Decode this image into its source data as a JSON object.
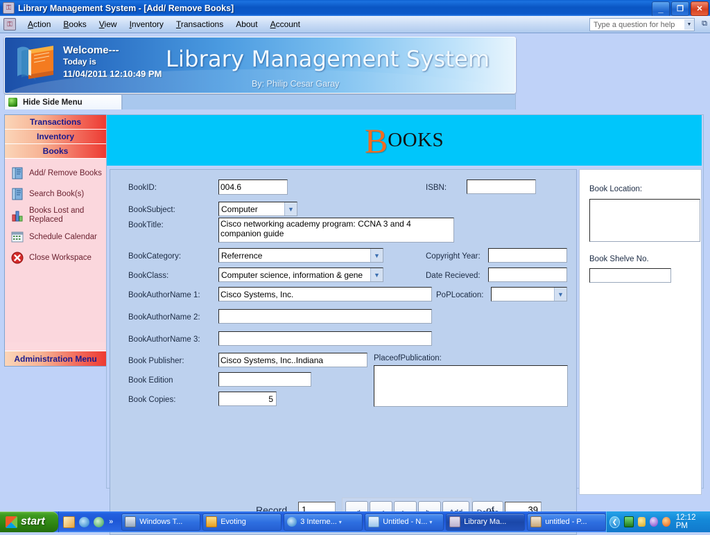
{
  "window": {
    "title": "Library Management System  - [Add/ Remove Books]",
    "app_icon": "key-icon",
    "minimize_label": "_",
    "restore_label": "❐",
    "close_label": "✕"
  },
  "menubar": {
    "items": [
      {
        "label": "Action",
        "mnemonic": "A"
      },
      {
        "label": "Books",
        "mnemonic": "B"
      },
      {
        "label": "View",
        "mnemonic": "V"
      },
      {
        "label": "Inventory",
        "mnemonic": "I"
      },
      {
        "label": "Transactions",
        "mnemonic": "T"
      },
      {
        "label": "About",
        "mnemonic": ""
      },
      {
        "label": "Account",
        "mnemonic": "A"
      }
    ],
    "help_placeholder": "Type a question for help"
  },
  "banner": {
    "welcome": "Welcome---",
    "today_is": "Today is",
    "datetime": "11/04/2011 12:10:49 PM",
    "title": "Library Management System",
    "byline": "By: Philip Cesar Garay",
    "icon": "book-icon"
  },
  "tabrow": {
    "hide_side_menu": "Hide Side Menu"
  },
  "sidebar": {
    "sections": [
      {
        "label": "Transactions"
      },
      {
        "label": "Inventory"
      },
      {
        "label": "Books"
      }
    ],
    "items": [
      {
        "label": "Add/ Remove Books",
        "icon": "book-icon"
      },
      {
        "label": "Search Book(s)",
        "icon": "book-icon"
      },
      {
        "label": "Books Lost and Replaced",
        "icon": "bar-chart-icon"
      },
      {
        "label": "Schedule Calendar",
        "icon": "calendar-icon"
      },
      {
        "label": "Close Workspace",
        "icon": "close-circle-icon"
      }
    ],
    "footer": "Administration Menu"
  },
  "main": {
    "heading_first_letter": "B",
    "heading_rest": "OOKS",
    "heading_accent_color": "#F26B21",
    "header_bg_color": "#00C6FB",
    "form": {
      "book_id": {
        "label": "BookID:",
        "value": "004.6"
      },
      "book_subject": {
        "label": "BookSubject:",
        "value": "Computer"
      },
      "book_title": {
        "label": "BookTitle:",
        "value": "Cisco networking academy program: CCNA 3 and 4 companion guide"
      },
      "book_category": {
        "label": "BookCategory:",
        "value": "Referrence"
      },
      "book_class": {
        "label": "BookClass:",
        "value": "Computer science, information & gene"
      },
      "author1": {
        "label": "BookAuthorName 1:",
        "value": "Cisco Systems, Inc."
      },
      "author2": {
        "label": "BookAuthorName 2:",
        "value": ""
      },
      "author3": {
        "label": "BookAuthorName 3:",
        "value": ""
      },
      "publisher": {
        "label": "Book Publisher:",
        "value": "Cisco Systems, Inc..Indiana"
      },
      "edition": {
        "label": "Book Edition",
        "value": ""
      },
      "copies": {
        "label": "Book Copies:",
        "value": "5"
      },
      "isbn": {
        "label": "ISBN:",
        "value": ""
      },
      "copyright_year": {
        "label": "Copyright Year:",
        "value": ""
      },
      "date_recieved": {
        "label": "Date Recieved:",
        "value": ""
      },
      "pop_location": {
        "label": "PoPLocation:",
        "value": ""
      },
      "place_of_publication": {
        "label": "PlaceofPublication:",
        "value": ""
      }
    },
    "right_panel": {
      "book_location": {
        "label": "Book Location:",
        "value": ""
      },
      "book_shelve_no": {
        "label": "Book Shelve No.",
        "value": ""
      }
    },
    "record_nav": {
      "record_label": "Record",
      "record_value": "1",
      "of_label": "of",
      "total_value": "39",
      "first_label": "◀|",
      "prev_label": "◀",
      "next_label": "▶",
      "last_label": "|▶",
      "add_label": "Add",
      "delete_label": "Delete"
    }
  },
  "taskbar": {
    "start_label": "start",
    "quicklaunch_chevron": "»",
    "tasks": [
      {
        "label": "Windows T...",
        "active": false,
        "icon": "monitor-icon"
      },
      {
        "label": "Evoting",
        "active": false,
        "icon": "folder-icon"
      },
      {
        "label": "3 Interne...",
        "active": false,
        "icon": "ie-icon",
        "caret": "▾"
      },
      {
        "label": "Untitled - N...",
        "active": false,
        "icon": "notepad-icon",
        "caret": "▾"
      },
      {
        "label": "Library Ma...",
        "active": true,
        "icon": "key-icon"
      },
      {
        "label": "untitled - P...",
        "active": false,
        "icon": "paint-icon"
      }
    ],
    "tray_chevron": "❮",
    "clock": "12:12 PM"
  }
}
